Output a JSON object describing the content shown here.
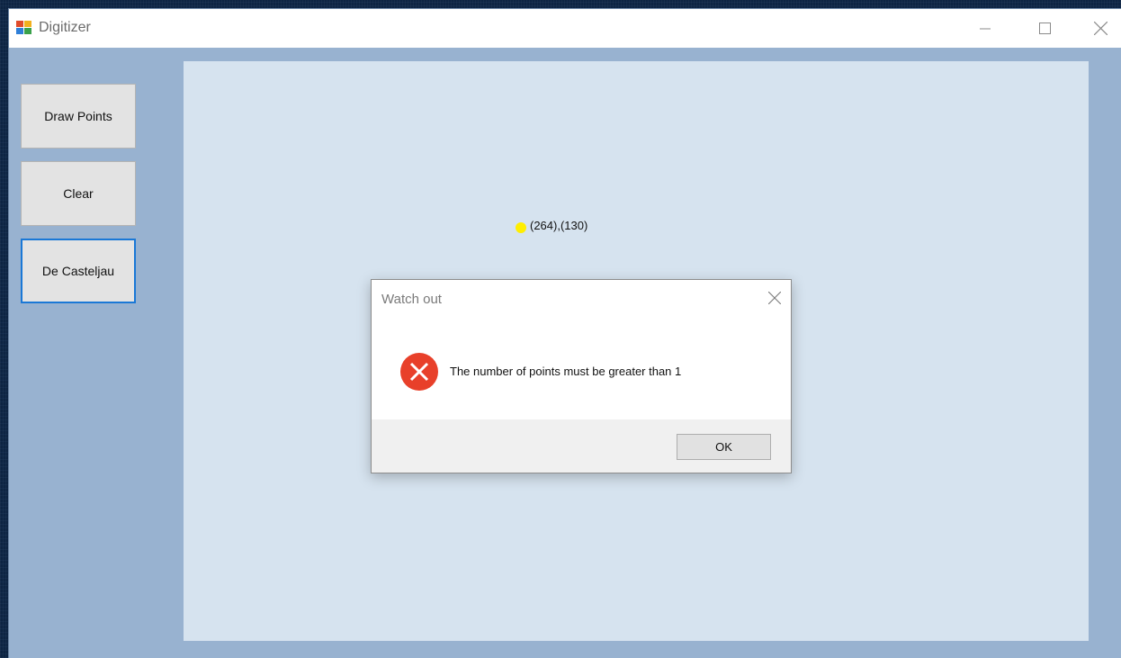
{
  "window": {
    "title": "Digitizer",
    "icon": "windows-forms-app-icon"
  },
  "window_controls": {
    "minimize": "minimize-icon",
    "maximize": "maximize-icon",
    "close": "close-icon"
  },
  "sidebar": {
    "buttons": [
      {
        "label": "Draw Points"
      },
      {
        "label": "Clear"
      },
      {
        "label": "De Casteljau",
        "focused": true
      }
    ]
  },
  "canvas": {
    "point": {
      "label": "(264),(130)",
      "color": "#ffee00"
    }
  },
  "dialog": {
    "title": "Watch out",
    "icon": "error-icon",
    "message": "The number of points must be greater than 1",
    "ok_label": "OK"
  },
  "colors": {
    "window_background": "#98b2d0",
    "canvas_background": "#d6e3ef",
    "focus_border": "#1a78d6",
    "error_red": "#e8402a"
  }
}
